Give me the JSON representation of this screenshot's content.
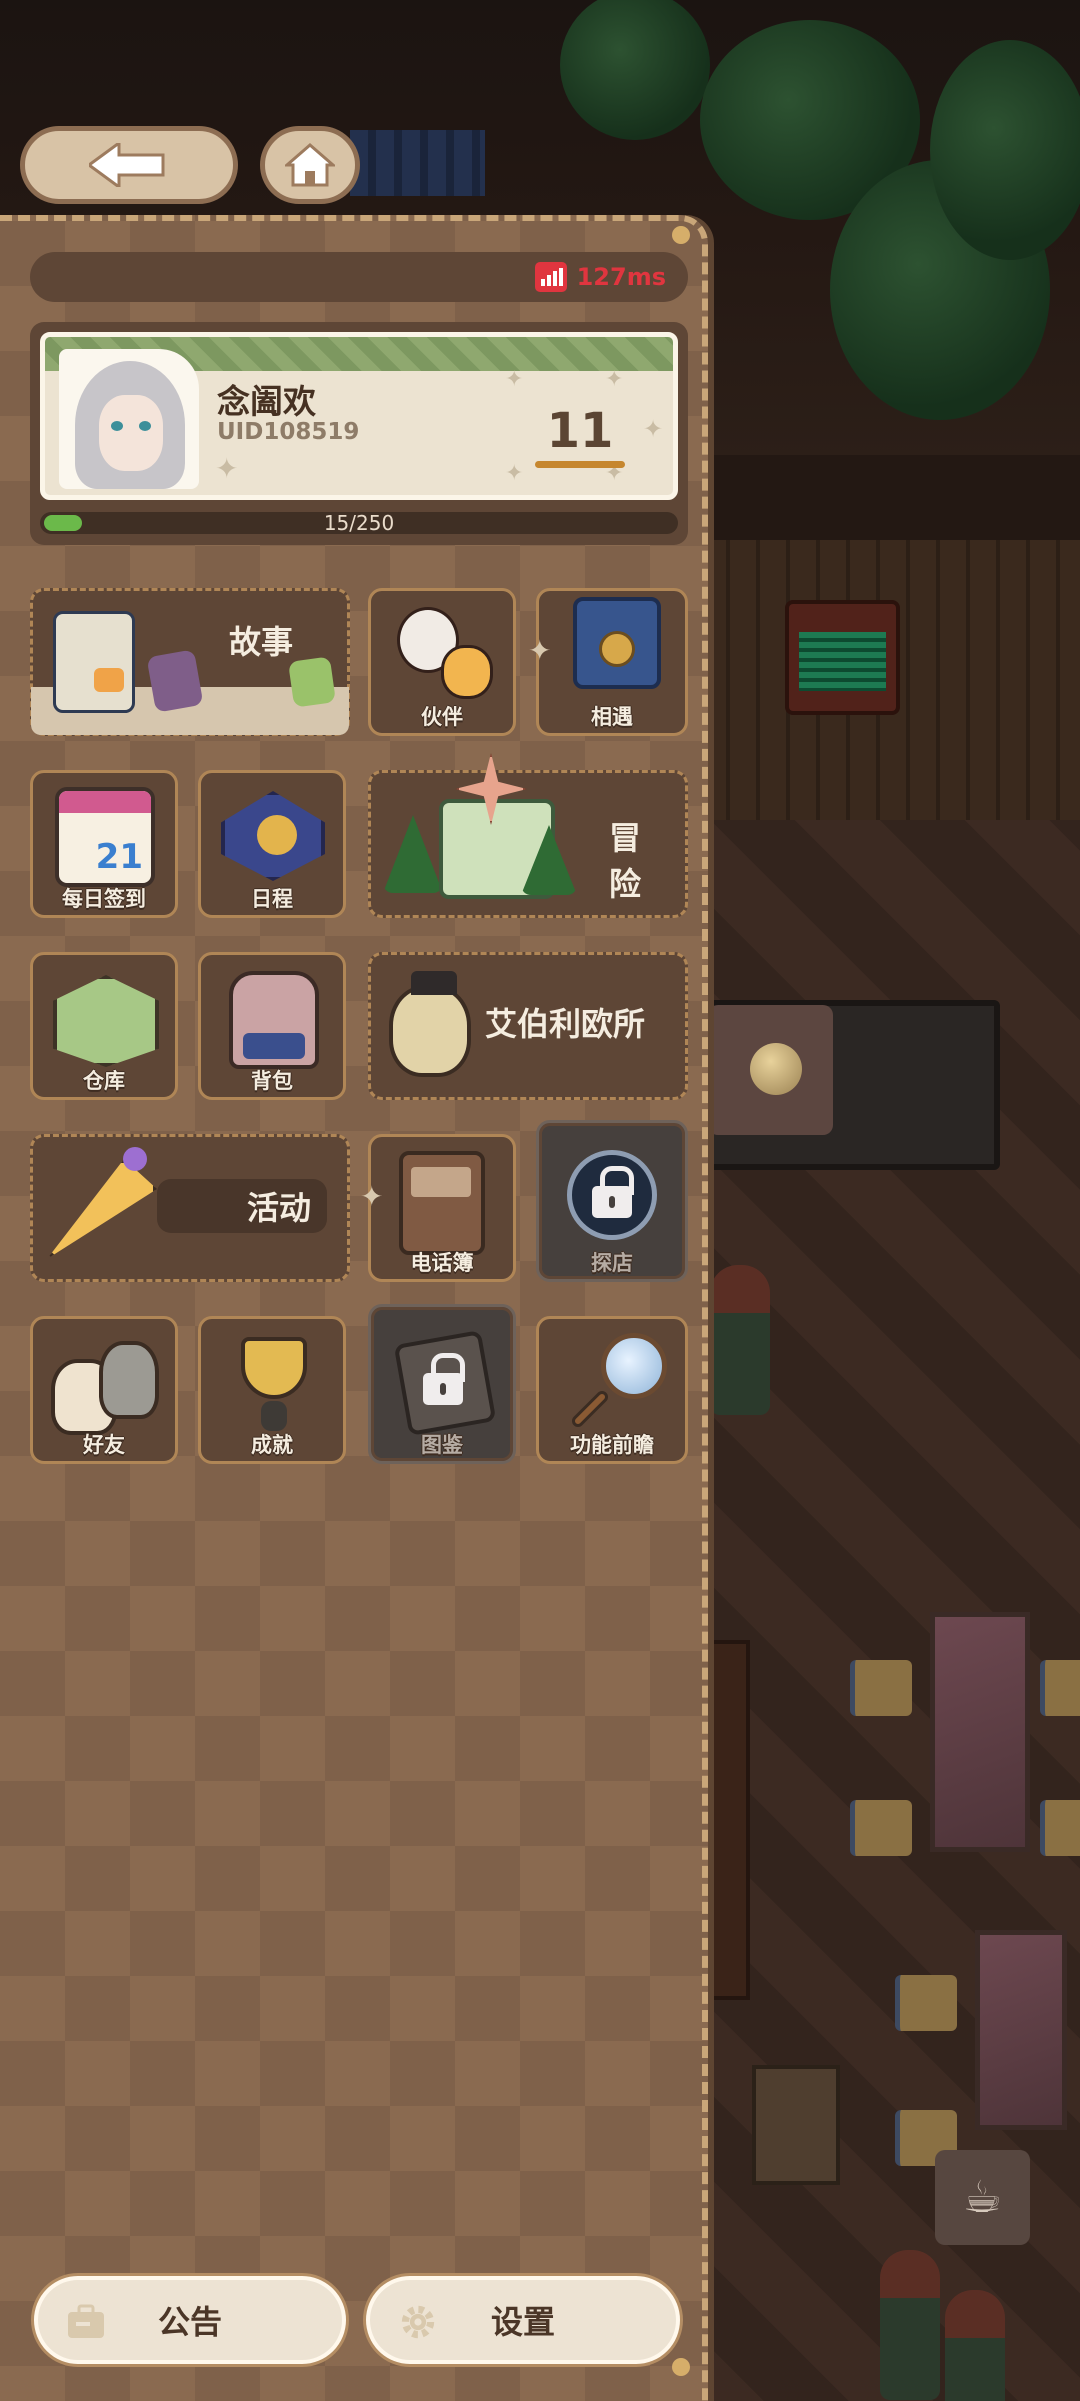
{
  "header": {
    "ping": "127ms"
  },
  "profile": {
    "nickname": "念阖欢",
    "uid": "UID108519",
    "level": "11",
    "xp_text": "15/250",
    "xp_progress": 0.06
  },
  "menu": {
    "story": "故事",
    "partner": "伙伴",
    "encounter": "相遇",
    "daily_checkin": "每日签到",
    "schedule": "日程",
    "adventure": "冒险",
    "warehouse": "仓库",
    "backpack": "背包",
    "abelio": "艾伯利欧所",
    "activity": "活动",
    "phonebook": "电话簿",
    "explore": "探店",
    "friends": "好友",
    "achievement": "成就",
    "codex": "图鉴",
    "preview": "功能前瞻",
    "calendar_day": "21"
  },
  "footer": {
    "notice": "公告",
    "settings": "设置"
  },
  "colors": {
    "ping_red": "#e0353f",
    "xp_green": "#6bb94a",
    "panel_brown": "#8a6a50",
    "accent_gold": "#c9a679"
  }
}
